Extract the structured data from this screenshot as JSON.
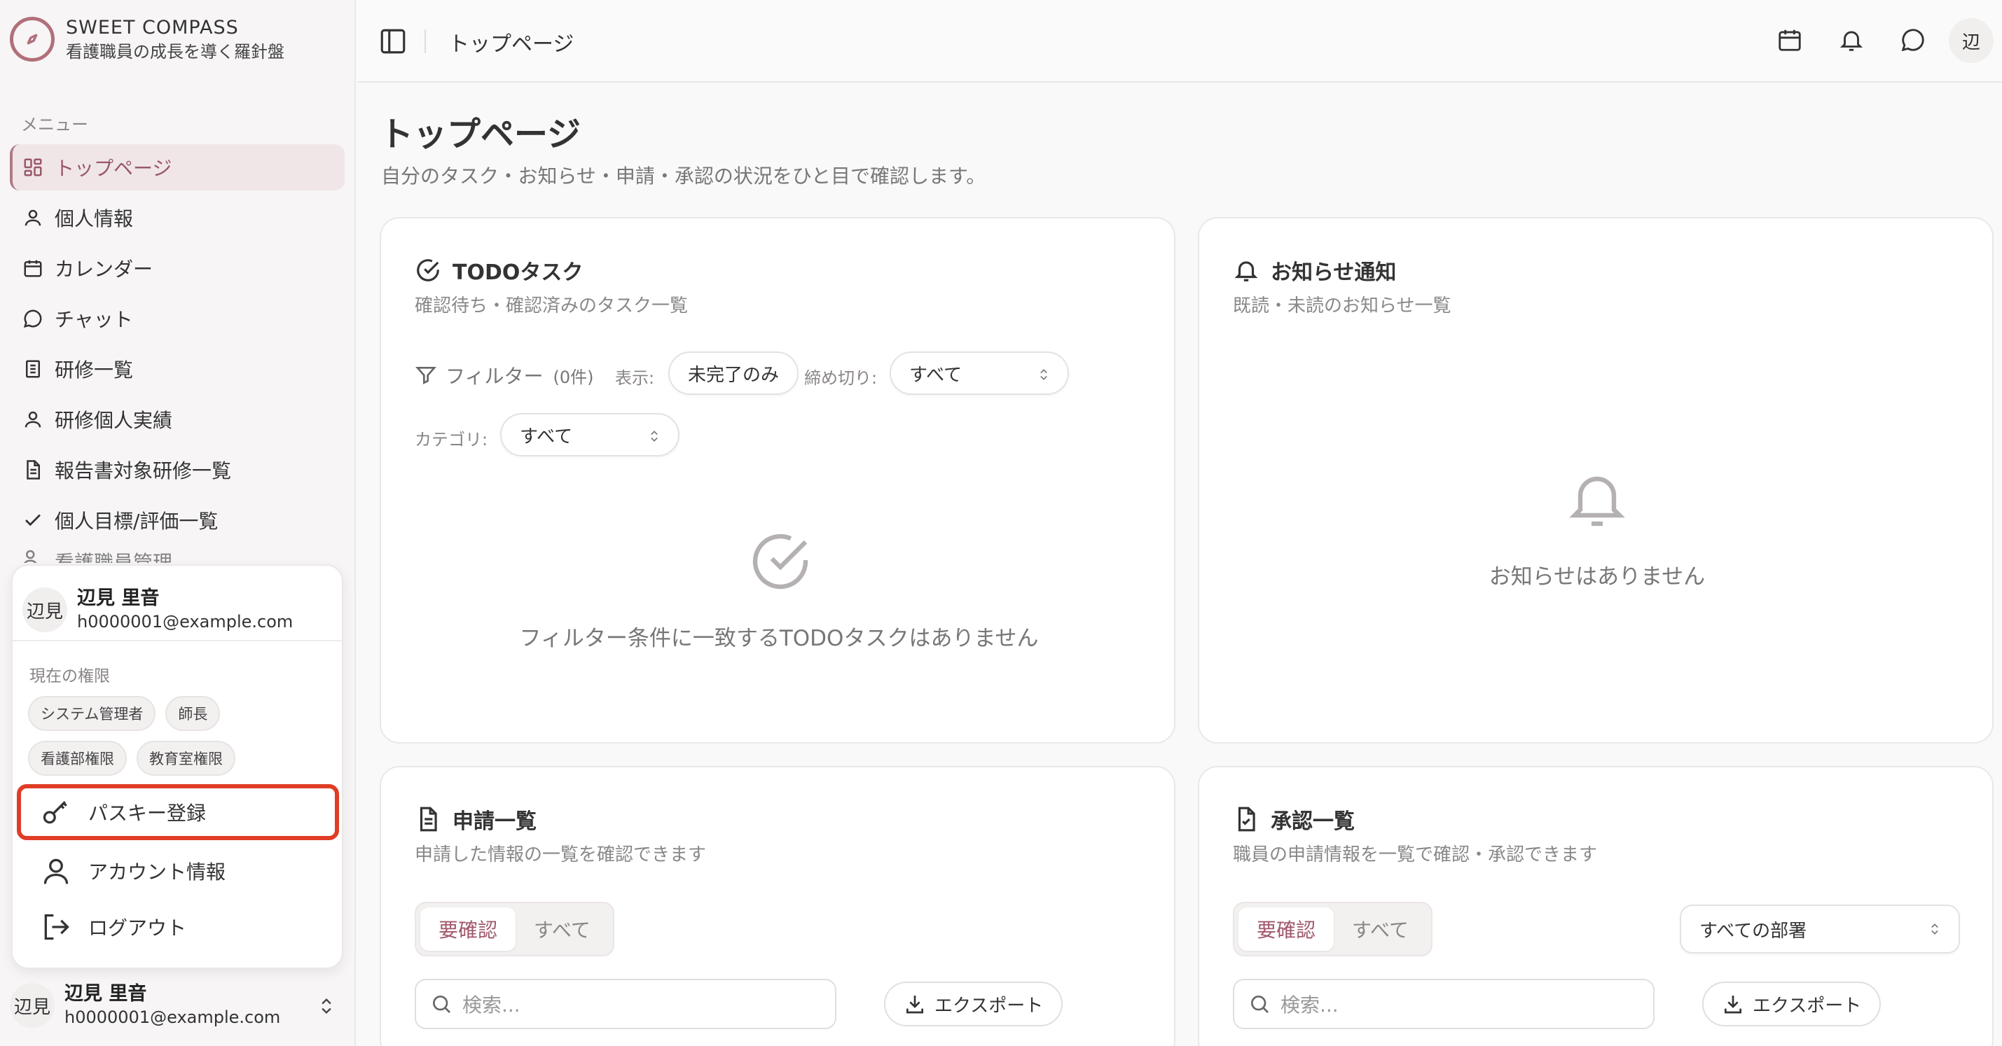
{
  "brand": {
    "name": "SWEET COMPASS",
    "subtitle": "看護職員の成長を導く羅針盤"
  },
  "sidebar": {
    "menu_title": "メニュー",
    "items": [
      {
        "label": "トップページ"
      },
      {
        "label": "個人情報"
      },
      {
        "label": "カレンダー"
      },
      {
        "label": "チャット"
      },
      {
        "label": "研修一覧"
      },
      {
        "label": "研修個人実績"
      },
      {
        "label": "報告書対象研修一覧"
      },
      {
        "label": "個人目標/評価一覧"
      },
      {
        "label": "看護職員管理"
      }
    ]
  },
  "user_popup": {
    "avatar": "辺見",
    "name": "辺見 里音",
    "email": "h0000001@example.com",
    "perm_title": "現在の権限",
    "badges": [
      "システム管理者",
      "師長",
      "看護部権限",
      "教育室権限"
    ],
    "actions": {
      "passkey": "パスキー登録",
      "account": "アカウント情報",
      "logout": "ログアウト"
    }
  },
  "user_footer": {
    "avatar": "辺見",
    "name": "辺見 里音",
    "email": "h0000001@example.com"
  },
  "topbar": {
    "title": "トップページ",
    "avatar": "辺"
  },
  "page": {
    "title": "トップページ",
    "subtitle": "自分のタスク・お知らせ・申請・承認の状況をひと目で確認します。"
  },
  "todo": {
    "title": "TODOタスク",
    "desc": "確認待ち・確認済みのタスク一覧",
    "filter_label": "フィルター",
    "filter_count": "(0件)",
    "display_label": "表示:",
    "display_value": "未完了のみ",
    "deadline_label": "締め切り:",
    "deadline_value": "すべて",
    "category_label": "カテゴリ:",
    "category_value": "すべて",
    "empty": "フィルター条件に一致するTODOタスクはありません"
  },
  "notice": {
    "title": "お知らせ通知",
    "desc": "既読・未読のお知らせ一覧",
    "empty": "お知らせはありません"
  },
  "requests": {
    "title": "申請一覧",
    "desc": "申請した情報の一覧を確認できます",
    "tab_on": "要確認",
    "tab_off": "すべて",
    "search_placeholder": "検索...",
    "export": "エクスポート"
  },
  "approvals": {
    "title": "承認一覧",
    "desc": "職員の申請情報を一覧で確認・承認できます",
    "tab_on": "要確認",
    "tab_off": "すべて",
    "dept_value": "すべての部署",
    "search_placeholder": "検索...",
    "export": "エクスポート"
  },
  "colors": {
    "accent": "#a0586a",
    "highlight": "#e03c26"
  }
}
